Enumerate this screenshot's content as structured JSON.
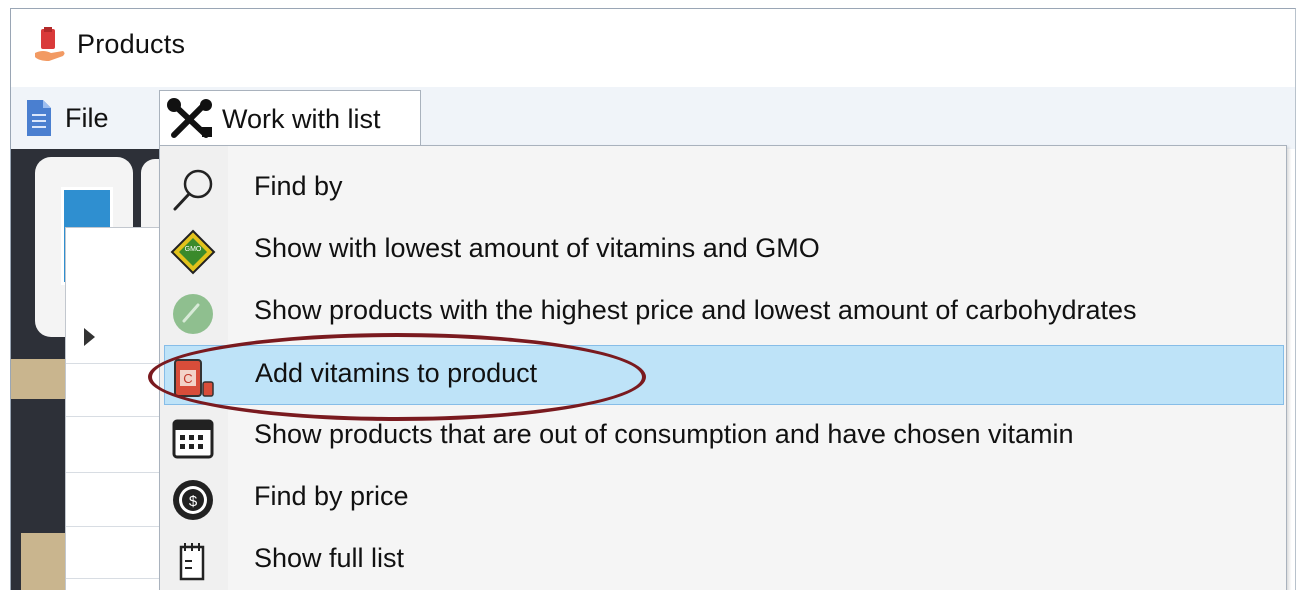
{
  "window": {
    "title": "Products",
    "app_icon": "hand-bag-icon"
  },
  "menubar": {
    "file": {
      "label": "File",
      "icon": "document-icon"
    },
    "work_with_list": {
      "label": "Work with list",
      "icon": "tools-icon"
    }
  },
  "dropdown": {
    "items": [
      {
        "label": "Find by",
        "icon": "magnifier-icon"
      },
      {
        "label": "Show with lowest amount of vitamins and GMO",
        "icon": "gmo-badge-icon"
      },
      {
        "label": "Show products with the highest price and lowest amount of carbohydrates",
        "icon": "green-circle-icon"
      },
      {
        "label": "Add vitamins to product",
        "icon": "vitamin-bottle-icon",
        "highlighted": true
      },
      {
        "label": "Show products that are out of consumption and have chosen vitamin",
        "icon": "calendar-icon"
      },
      {
        "label": "Find by price",
        "icon": "dollar-coin-icon"
      },
      {
        "label": "Show full list",
        "icon": "notepad-icon"
      }
    ]
  },
  "colors": {
    "highlight": "#bee3f8",
    "highlight_border": "#86bde8",
    "annotation": "#7a1a1f",
    "menubar": "#f0f4f9"
  }
}
